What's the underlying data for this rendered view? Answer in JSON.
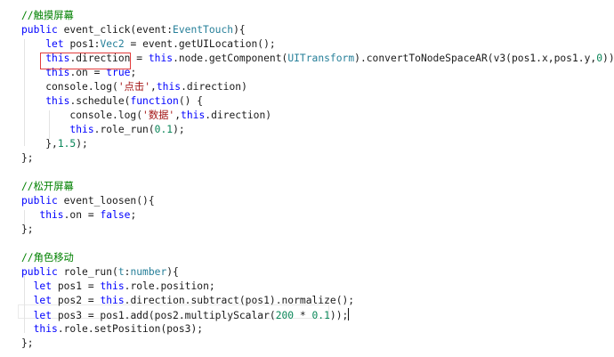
{
  "colors": {
    "keyword": "#0000ff",
    "comment": "#008000",
    "type": "#267f99",
    "string": "#a31515",
    "number": "#098658",
    "plain": "#1a1a1a",
    "highlight_box": "#e23b3b"
  },
  "code_lines": [
    [
      {
        "t": "//触摸屏幕",
        "c": "comment"
      }
    ],
    [
      {
        "t": "public ",
        "c": "keyword"
      },
      {
        "t": "event_click(event:",
        "c": "plain"
      },
      {
        "t": "EventTouch",
        "c": "type"
      },
      {
        "t": "){",
        "c": "plain"
      }
    ],
    [
      {
        "t": "    ",
        "c": "plain"
      },
      {
        "t": "let ",
        "c": "keyword"
      },
      {
        "t": "pos1:",
        "c": "plain"
      },
      {
        "t": "Vec2",
        "c": "type"
      },
      {
        "t": " = event.getUILocation();",
        "c": "plain"
      }
    ],
    [
      {
        "t": "    ",
        "c": "plain"
      },
      {
        "t": "this",
        "c": "keyword"
      },
      {
        "t": ".direction = ",
        "c": "plain"
      },
      {
        "t": "this",
        "c": "keyword"
      },
      {
        "t": ".node.getComponent(",
        "c": "plain"
      },
      {
        "t": "UITransform",
        "c": "type"
      },
      {
        "t": ").convertToNodeSpaceAR(v3(pos1.x,pos1.y,",
        "c": "plain"
      },
      {
        "t": "0",
        "c": "number"
      },
      {
        "t": "));",
        "c": "plain"
      }
    ],
    [
      {
        "t": "    ",
        "c": "plain"
      },
      {
        "t": "this",
        "c": "keyword"
      },
      {
        "t": ".on = ",
        "c": "plain"
      },
      {
        "t": "true",
        "c": "keyword"
      },
      {
        "t": ";",
        "c": "plain"
      }
    ],
    [
      {
        "t": "    console.log(",
        "c": "plain"
      },
      {
        "t": "'点击'",
        "c": "string"
      },
      {
        "t": ",",
        "c": "plain"
      },
      {
        "t": "this",
        "c": "keyword"
      },
      {
        "t": ".direction)",
        "c": "plain"
      }
    ],
    [
      {
        "t": "    ",
        "c": "plain"
      },
      {
        "t": "this",
        "c": "keyword"
      },
      {
        "t": ".schedule(",
        "c": "plain"
      },
      {
        "t": "function",
        "c": "keyword"
      },
      {
        "t": "() {",
        "c": "plain"
      }
    ],
    [
      {
        "t": "        console.log(",
        "c": "plain"
      },
      {
        "t": "'数据'",
        "c": "string"
      },
      {
        "t": ",",
        "c": "plain"
      },
      {
        "t": "this",
        "c": "keyword"
      },
      {
        "t": ".direction)",
        "c": "plain"
      }
    ],
    [
      {
        "t": "        ",
        "c": "plain"
      },
      {
        "t": "this",
        "c": "keyword"
      },
      {
        "t": ".role_run(",
        "c": "plain"
      },
      {
        "t": "0.1",
        "c": "number"
      },
      {
        "t": ");",
        "c": "plain"
      }
    ],
    [
      {
        "t": "    },",
        "c": "plain"
      },
      {
        "t": "1.5",
        "c": "number"
      },
      {
        "t": ");",
        "c": "plain"
      }
    ],
    [
      {
        "t": "};",
        "c": "plain"
      }
    ],
    [],
    [
      {
        "t": "//松开屏幕",
        "c": "comment"
      }
    ],
    [
      {
        "t": "public ",
        "c": "keyword"
      },
      {
        "t": "event_loosen(){",
        "c": "plain"
      }
    ],
    [
      {
        "t": "   ",
        "c": "plain"
      },
      {
        "t": "this",
        "c": "keyword"
      },
      {
        "t": ".on = ",
        "c": "plain"
      },
      {
        "t": "false",
        "c": "keyword"
      },
      {
        "t": ";",
        "c": "plain"
      }
    ],
    [
      {
        "t": "};",
        "c": "plain"
      }
    ],
    [],
    [
      {
        "t": "//角色移动",
        "c": "comment"
      }
    ],
    [
      {
        "t": "public ",
        "c": "keyword"
      },
      {
        "t": "role_run(",
        "c": "plain"
      },
      {
        "t": "t",
        "c": "type"
      },
      {
        "t": ":",
        "c": "plain"
      },
      {
        "t": "number",
        "c": "type"
      },
      {
        "t": "){",
        "c": "plain"
      }
    ],
    [
      {
        "t": "  ",
        "c": "plain"
      },
      {
        "t": "let ",
        "c": "keyword"
      },
      {
        "t": "pos1 = ",
        "c": "plain"
      },
      {
        "t": "this",
        "c": "keyword"
      },
      {
        "t": ".role.position;",
        "c": "plain"
      }
    ],
    [
      {
        "t": "  ",
        "c": "plain"
      },
      {
        "t": "let ",
        "c": "keyword"
      },
      {
        "t": "pos2 = ",
        "c": "plain"
      },
      {
        "t": "this",
        "c": "keyword"
      },
      {
        "t": ".direction.subtract(pos1).normalize();",
        "c": "plain"
      }
    ],
    [
      {
        "t": "  ",
        "c": "plain"
      },
      {
        "t": "let ",
        "c": "keyword"
      },
      {
        "t": "pos3 = pos1.add(pos2.multiplyScalar(",
        "c": "plain"
      },
      {
        "t": "200",
        "c": "number"
      },
      {
        "t": " * ",
        "c": "plain"
      },
      {
        "t": "0.1",
        "c": "number"
      },
      {
        "t": "));",
        "c": "plain"
      }
    ],
    [
      {
        "t": "  ",
        "c": "plain"
      },
      {
        "t": "this",
        "c": "keyword"
      },
      {
        "t": ".role.setPosition(pos3);",
        "c": "plain"
      }
    ],
    [
      {
        "t": "};",
        "c": "plain"
      }
    ]
  ]
}
